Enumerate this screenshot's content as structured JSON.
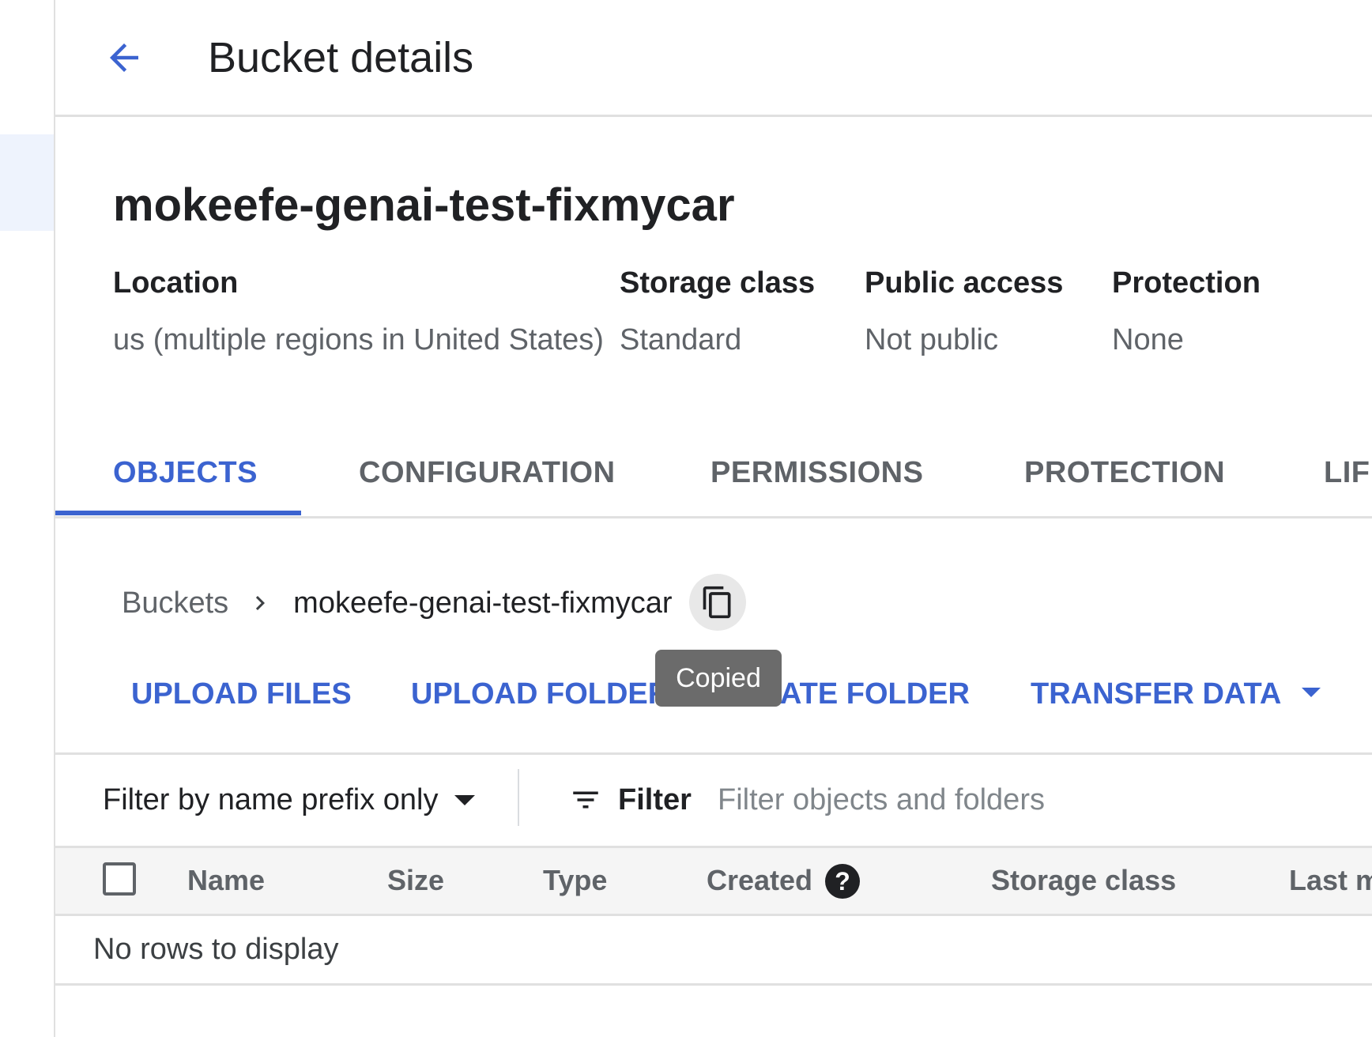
{
  "header": {
    "title": "Bucket details",
    "back_icon": "arrow-back-icon"
  },
  "bucket": {
    "name": "mokeefe-genai-test-fixmycar",
    "meta": [
      {
        "label": "Location",
        "value": "us (multiple regions in United States)"
      },
      {
        "label": "Storage class",
        "value": "Standard"
      },
      {
        "label": "Public access",
        "value": "Not public"
      },
      {
        "label": "Protection",
        "value": "None"
      }
    ]
  },
  "tabs": [
    {
      "label": "OBJECTS",
      "active": true
    },
    {
      "label": "CONFIGURATION",
      "active": false
    },
    {
      "label": "PERMISSIONS",
      "active": false
    },
    {
      "label": "PROTECTION",
      "active": false
    },
    {
      "label": "LIFE",
      "active": false
    }
  ],
  "breadcrumb": {
    "root": "Buckets",
    "current": "mokeefe-genai-test-fixmycar",
    "separator_icon": "chevron-right-icon",
    "copy_icon": "copy-icon"
  },
  "tooltip": {
    "text": "Copied"
  },
  "actions": {
    "upload_files": "UPLOAD FILES",
    "upload_folder": "UPLOAD FOLDER",
    "create_folder": "ATE FOLDER",
    "transfer_data": "TRANSFER DATA"
  },
  "filter": {
    "mode": "Filter by name prefix only",
    "label": "Filter",
    "placeholder": "Filter objects and folders",
    "icon": "filter-list-icon"
  },
  "table": {
    "columns": [
      "Name",
      "Size",
      "Type",
      "Created",
      "Storage class",
      "Last m"
    ],
    "help_icon_glyph": "?",
    "empty_text": "No rows to display"
  },
  "colors": {
    "accent": "#3b63d0",
    "tooltip_bg": "#6b6b6b",
    "header_bg": "#f5f5f5"
  }
}
